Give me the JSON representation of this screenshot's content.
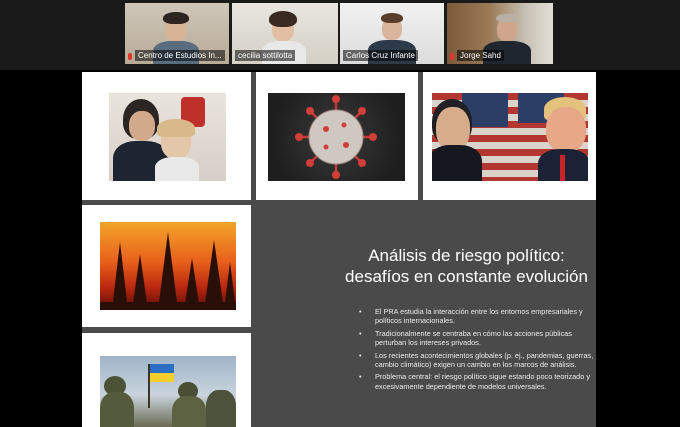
{
  "participants": [
    {
      "name": "Centro de Estudios In...",
      "muted": true,
      "active": false
    },
    {
      "name": "cecilia sottilotta",
      "muted": false,
      "active": true
    },
    {
      "name": "Carlos Cruz Infante",
      "muted": false,
      "active": false
    },
    {
      "name": "Jorge Sahd",
      "muted": true,
      "active": false
    }
  ],
  "slide": {
    "title_line1": "Análisis de riesgo político:",
    "title_line2": "desafíos en constante evolución",
    "bullets": [
      "El PRA estudia la interacción entre los entornos empresariales y políticos internacionales.",
      "Tradicionalmente se centraba en cómo las acciones públicas perturban los intereses privados.",
      "Los recientes acontecimientos globales (p. ej., pandemias, guerras, cambio climático) exigen un cambio en los marcos de análisis.",
      "Problema central: el riesgo político sigue estando poco teorizado y excesivamente dependiente de modelos universales."
    ],
    "bullet_symbol": "•"
  },
  "colors": {
    "active_speaker": "#2fa84f",
    "mic_muted": "#e0362c",
    "slide_bg": "#4a4a4a"
  }
}
